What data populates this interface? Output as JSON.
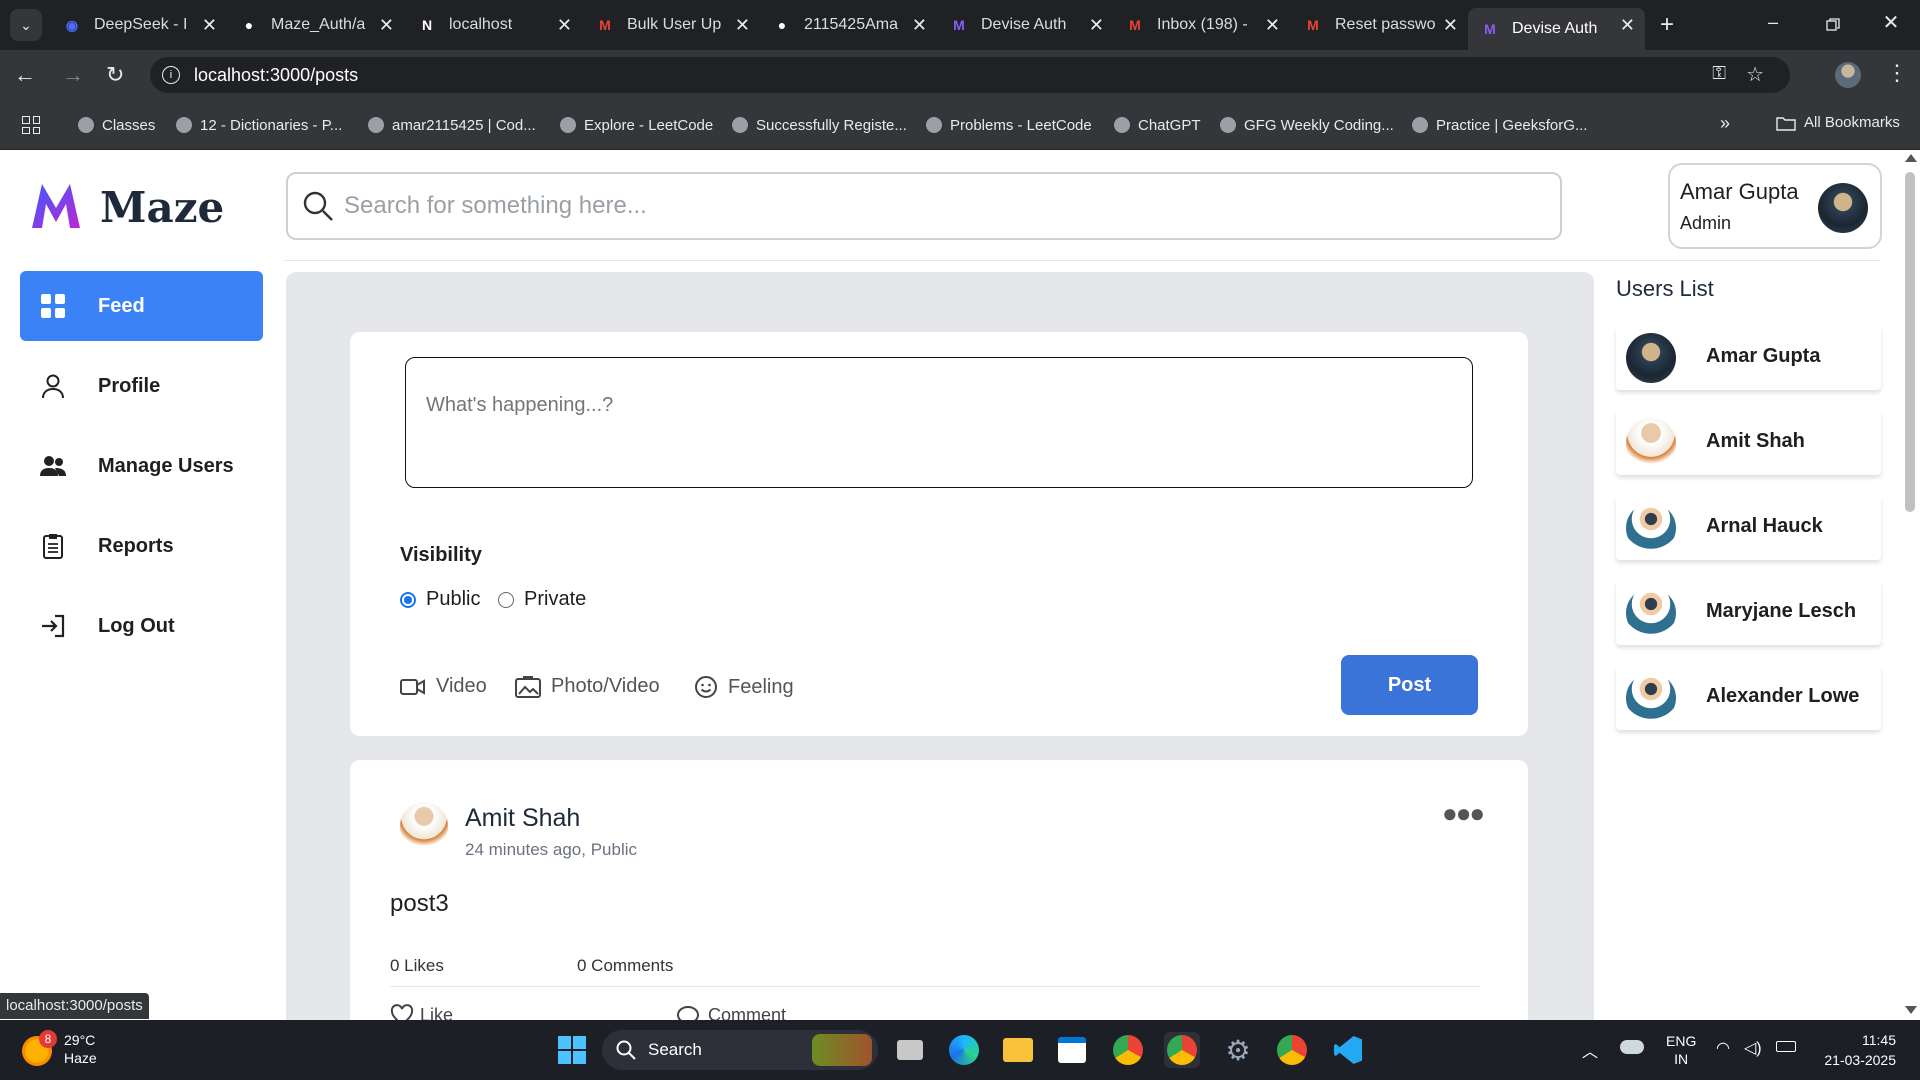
{
  "browser": {
    "tabs": [
      {
        "title": "DeepSeek - I",
        "icon": "deepseek-icon",
        "color": "#4d6bfe"
      },
      {
        "title": "Maze_Auth/a",
        "icon": "github-icon",
        "color": "#ffffff"
      },
      {
        "title": "localhost",
        "icon": "notion-icon",
        "color": "#ffffff"
      },
      {
        "title": "Bulk User Up",
        "icon": "gmail-icon",
        "color": "#ea4335"
      },
      {
        "title": "2115425Ama",
        "icon": "github-icon",
        "color": "#ffffff"
      },
      {
        "title": "Devise Auth",
        "icon": "maze-icon",
        "color": "#8b5cf6"
      },
      {
        "title": "Inbox (198) -",
        "icon": "gmail-icon",
        "color": "#ea4335"
      },
      {
        "title": "Reset passwo",
        "icon": "gmail-icon",
        "color": "#ea4335"
      },
      {
        "title": "Devise Auth",
        "icon": "maze-icon",
        "color": "#8b5cf6"
      }
    ],
    "url": "localhost:3000/posts",
    "bookmarks": [
      "Classes",
      "12 - Dictionaries - P...",
      "amar2115425 | Cod...",
      "Explore - LeetCode",
      "Successfully Registe...",
      "Problems - LeetCode",
      "ChatGPT",
      "GFG Weekly Coding...",
      "Practice | GeeksforG..."
    ],
    "all_bookmarks": "All Bookmarks",
    "status_url": "localhost:3000/posts"
  },
  "app": {
    "brand": "Maze",
    "search_placeholder": "Search for something here...",
    "user": {
      "name": "Amar Gupta",
      "role": "Admin"
    },
    "nav": [
      {
        "label": "Feed",
        "icon": "grid-icon"
      },
      {
        "label": "Profile",
        "icon": "person-icon"
      },
      {
        "label": "Manage Users",
        "icon": "users-icon"
      },
      {
        "label": "Reports",
        "icon": "clipboard-icon"
      },
      {
        "label": "Log Out",
        "icon": "logout-icon"
      }
    ],
    "composer": {
      "placeholder": "What's happening...?",
      "visibility_label": "Visibility",
      "public_label": "Public",
      "private_label": "Private",
      "selected": "Public",
      "video_label": "Video",
      "photo_label": "Photo/Video",
      "feeling_label": "Feeling",
      "post_label": "Post"
    },
    "post": {
      "author": "Amit Shah",
      "meta": "24 minutes ago, Public",
      "body": "post3",
      "likes": "0 Likes",
      "comments": "0 Comments",
      "like_label": "Like",
      "comment_label": "Comment"
    },
    "users_list": {
      "title": "Users List",
      "users": [
        "Amar Gupta",
        "Amit Shah",
        "Arnal Hauck",
        "Maryjane Lesch",
        "Alexander Lowe"
      ]
    },
    "accent": "#3b82f6"
  },
  "taskbar": {
    "weather_temp": "29°C",
    "weather_desc": "Haze",
    "weather_badge": "8",
    "search_label": "Search",
    "lang_line1": "ENG",
    "lang_line2": "IN",
    "time": "11:45",
    "date": "21-03-2025"
  }
}
